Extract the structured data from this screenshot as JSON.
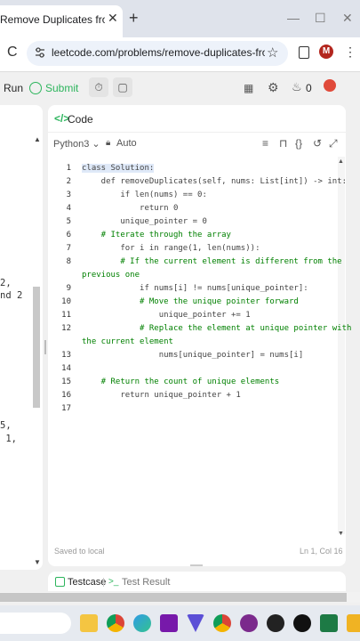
{
  "browser": {
    "tab_title": "Remove Duplicates from Sorted",
    "tab_close": "✕",
    "new_tab": "+",
    "url": "leetcode.com/problems/remove-duplicates-from-sort...",
    "profile_initial": "M"
  },
  "toolbar": {
    "run_label": "Run",
    "submit_label": "Submit",
    "streak_count": "0"
  },
  "left_panel": {
    "fragments": [
      "2,",
      "nd 2",
      "5,",
      " 1,"
    ]
  },
  "code_panel": {
    "title": "Code",
    "language": "Python3",
    "autocomplete": "Auto",
    "saved_status": "Saved to local",
    "cursor_position": "Ln 1, Col 16"
  },
  "code_lines": [
    {
      "n": "1",
      "text": "class Solution:"
    },
    {
      "n": "2",
      "text": "    def removeDuplicates(self, nums: List[int]) -> int:"
    },
    {
      "n": "3",
      "text": "        if len(nums) == 0:"
    },
    {
      "n": "4",
      "text": "            return 0"
    },
    {
      "n": "5",
      "text": "        unique_pointer = 0"
    },
    {
      "n": "6",
      "text": "    # Iterate through the array"
    },
    {
      "n": "7",
      "text": "        for i in range(1, len(nums)):"
    },
    {
      "n": "8",
      "text": "        # If the current element is different from the"
    },
    {
      "n": "",
      "text": "previous one"
    },
    {
      "n": "9",
      "text": "            if nums[i] != nums[unique_pointer]:"
    },
    {
      "n": "10",
      "text": "            # Move the unique pointer forward"
    },
    {
      "n": "11",
      "text": "                unique_pointer += 1"
    },
    {
      "n": "12",
      "text": "            # Replace the element at unique pointer with"
    },
    {
      "n": "",
      "text": "the current element"
    },
    {
      "n": "13",
      "text": "                nums[unique_pointer] = nums[i]"
    },
    {
      "n": "14",
      "text": ""
    },
    {
      "n": "15",
      "text": "    # Return the count of unique elements"
    },
    {
      "n": "16",
      "text": "        return unique_pointer + 1"
    },
    {
      "n": "17",
      "text": ""
    }
  ],
  "bottom_tabs": {
    "testcase": "Testcase",
    "test_result": "Test Result"
  },
  "taskbar": {
    "icons": [
      "file-explorer-icon",
      "chrome-icon",
      "edge-icon",
      "onenote-icon",
      "vpn-icon",
      "chrome-profile-icon",
      "github-icon",
      "app-icon",
      "openai-icon",
      "excel-icon",
      "app-icon-2"
    ]
  },
  "colors": {
    "accent_green": "#2db55d",
    "keyword_blue": "#0000d0",
    "comment_green": "#008000"
  }
}
